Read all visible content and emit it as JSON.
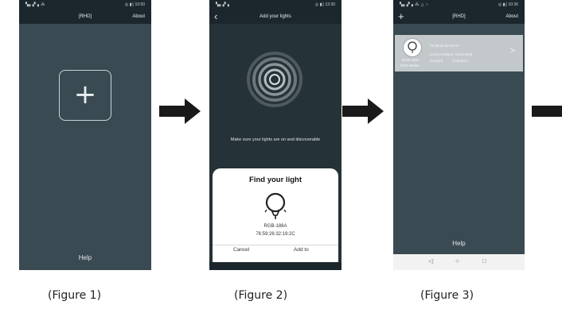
{
  "figure1": {
    "status_left": "▚▖▞▗ ⁂",
    "status_right": "◎ ▮▯ 10:50",
    "title": "[RHD]",
    "about": "About",
    "add_symbol": "+",
    "help": "Help",
    "caption": "(Figure 1)"
  },
  "figure2": {
    "status_left": "▚▖▞▗",
    "status_right": "◎ ▮▯ 13:30",
    "back": "‹",
    "title": "Add your lights",
    "hint": "Make sure your lights are on and discoverable",
    "sheet_title": "Find your light",
    "device_model": "RGB-188A",
    "device_mac": "76:59:26:32:19:2C",
    "cancel": "Cancel",
    "add": "Add to",
    "caption": "(Figure 2)"
  },
  "figure3": {
    "status_left": "▚▖▞▗ ⁂ △ ○",
    "status_right": "◎ ▮▯ 10:36",
    "add_symbol": "+",
    "title": "[RHD]",
    "about": "About",
    "device_name": "RGB-188A",
    "device_series": "RGB Series",
    "mac": "76:59:26:32:19:2C",
    "status": "Current Status: Connected",
    "group": "Group:8",
    "channel": "Channel:1",
    "help": "Help",
    "caption": "(Figure 3)"
  },
  "arrow_color": "#1a1a1a",
  "app_bg": "#3a4a52",
  "bar_bg": "#1c272d"
}
